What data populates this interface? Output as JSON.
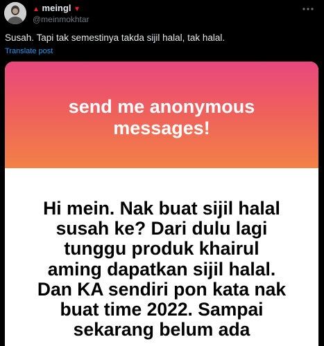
{
  "author": {
    "display_name": "meingl",
    "handle": "@meinmokhtar",
    "badge_prefix": "▲",
    "badge_suffix": "▼"
  },
  "tweet": {
    "text": "Susah. Tapi tak semestinya takda sijil halal, tak halal.",
    "translate_label": "Translate post"
  },
  "card": {
    "title_lines": [
      "send me anonymous",
      "messages!"
    ],
    "message_lines": [
      "Hi mein. Nak buat sijil halal",
      "susah ke? Dari dulu lagi",
      "tunggu produk khairul",
      "aming dapatkan sijil halal.",
      "Dan KA sendiri pon kata nak",
      "buat time 2022. Sampai",
      "sekarang belum ada"
    ],
    "gradient_colors": [
      "#e9477f",
      "#ee5f5d",
      "#f38146"
    ]
  },
  "colors": {
    "background": "#000000",
    "text_primary": "#e7e9ea",
    "text_secondary": "#71767b",
    "link": "#1d9bf0",
    "badge": "#f4212e"
  },
  "icons": {
    "more": "more-horizontal-icon",
    "avatar": "avatar"
  }
}
